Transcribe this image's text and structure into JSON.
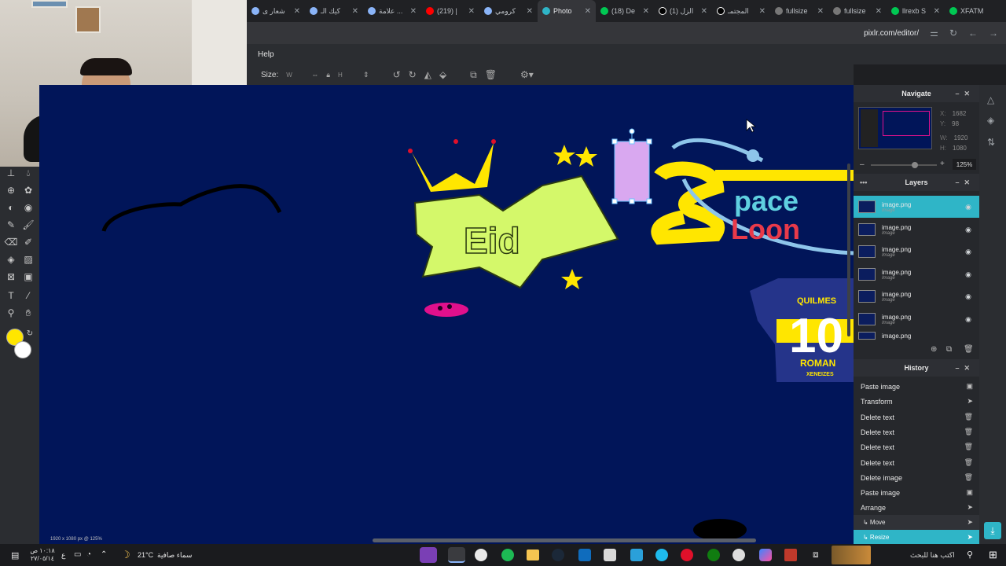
{
  "browser": {
    "tabs": [
      {
        "label": "شعار ی"
      },
      {
        "label": "كيك الـ"
      },
      {
        "label": "علامة ..."
      },
      {
        "label": "(219) |"
      },
      {
        "label": "كرومي"
      },
      {
        "label": "Photo"
      },
      {
        "label": "(18) De"
      },
      {
        "label": "(1) الزل"
      },
      {
        "label": "المجتمـ"
      },
      {
        "label": "fullsize"
      },
      {
        "label": "fullsize"
      },
      {
        "label": "llrexb S"
      },
      {
        "label": "XFATM"
      }
    ],
    "url": "pixlr.com/editor/"
  },
  "menu": {
    "help": "Help"
  },
  "options": {
    "size_label": "Size:",
    "width_placeholder": "W",
    "height_placeholder": "H"
  },
  "canvas": {
    "background": "#011559",
    "jersey_team": "QUILMES",
    "jersey_number": "10",
    "jersey_name": "ROMAN",
    "jersey_sub": "XENEIZES",
    "space_text": "pace",
    "loon_text": "Loon",
    "eid_text": "Eid"
  },
  "status": {
    "info": "1920 x 1080 px @ 125%"
  },
  "navigate": {
    "title": "Navigate",
    "x_label": "X:",
    "x_value": "1682",
    "y_label": "Y:",
    "y_value": "98",
    "w_label": "W:",
    "w_value": "1920",
    "h_label": "H:",
    "h_value": "1080",
    "zoom": "125%"
  },
  "layers": {
    "title": "Layers",
    "items": [
      {
        "name": "image.png",
        "type": "Image"
      },
      {
        "name": "image.png",
        "type": "Image"
      },
      {
        "name": "image.png",
        "type": "Image"
      },
      {
        "name": "image.png",
        "type": "Image"
      },
      {
        "name": "image.png",
        "type": "Image"
      },
      {
        "name": "image.png",
        "type": "Image"
      },
      {
        "name": "image.png",
        "type": ""
      }
    ]
  },
  "history": {
    "title": "History",
    "items": [
      {
        "label": "Paste image"
      },
      {
        "label": "Transform"
      },
      {
        "label": "Delete text"
      },
      {
        "label": "Delete text"
      },
      {
        "label": "Delete text"
      },
      {
        "label": "Delete text"
      },
      {
        "label": "Delete image"
      },
      {
        "label": "Paste image"
      },
      {
        "label": "Arrange"
      },
      {
        "label": "↳ Move"
      },
      {
        "label": "↳ Resize"
      }
    ]
  },
  "taskbar": {
    "search": "اكتب هنا للبحث",
    "weather_temp": "21°C",
    "weather_text": "سماء صافية",
    "time": "١٠:١٨ ص",
    "date": "٢٧/٠٥/١٤",
    "lang": "ع"
  },
  "colors": {
    "accent": "#2fb5c7",
    "foreground": "#ffe600",
    "background": "#ffffff"
  }
}
